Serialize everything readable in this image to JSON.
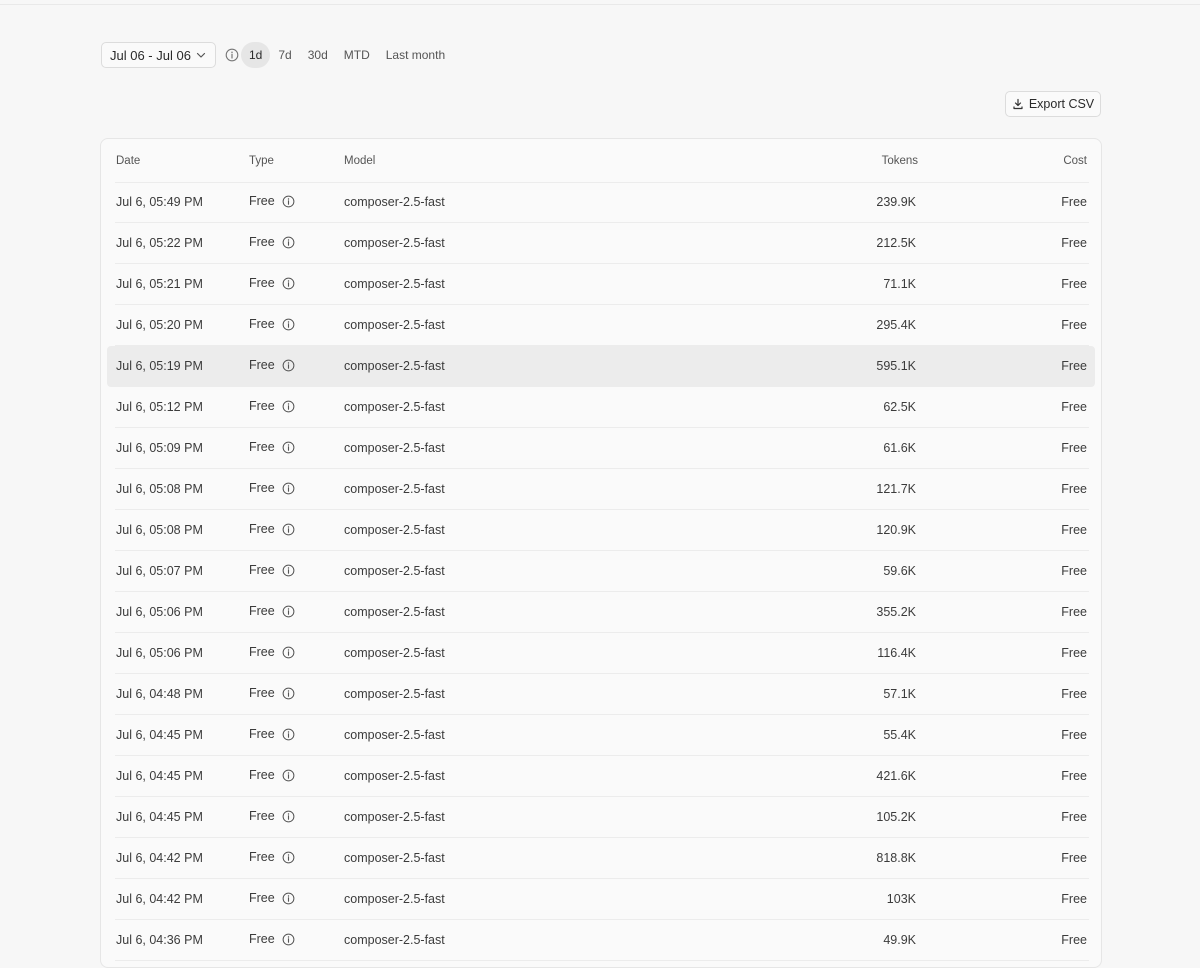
{
  "toolbar": {
    "date_range": "Jul 06 - Jul 06",
    "presets": [
      "1d",
      "7d",
      "30d",
      "MTD",
      "Last month"
    ],
    "active_preset": "1d",
    "icons": {
      "dropdown": "chevron-down-icon",
      "info": "info-icon"
    }
  },
  "export": {
    "label": "Export CSV",
    "icon": "download-icon"
  },
  "table": {
    "columns": [
      "Date",
      "Type",
      "Model",
      "Tokens",
      "Cost"
    ],
    "highlighted_row": 4,
    "rows": [
      {
        "date": "Jul 6, 05:49 PM",
        "type": "Free",
        "model": "composer-2.5-fast",
        "tokens": "239.9K",
        "cost": "Free"
      },
      {
        "date": "Jul 6, 05:22 PM",
        "type": "Free",
        "model": "composer-2.5-fast",
        "tokens": "212.5K",
        "cost": "Free"
      },
      {
        "date": "Jul 6, 05:21 PM",
        "type": "Free",
        "model": "composer-2.5-fast",
        "tokens": "71.1K",
        "cost": "Free"
      },
      {
        "date": "Jul 6, 05:20 PM",
        "type": "Free",
        "model": "composer-2.5-fast",
        "tokens": "295.4K",
        "cost": "Free"
      },
      {
        "date": "Jul 6, 05:19 PM",
        "type": "Free",
        "model": "composer-2.5-fast",
        "tokens": "595.1K",
        "cost": "Free"
      },
      {
        "date": "Jul 6, 05:12 PM",
        "type": "Free",
        "model": "composer-2.5-fast",
        "tokens": "62.5K",
        "cost": "Free"
      },
      {
        "date": "Jul 6, 05:09 PM",
        "type": "Free",
        "model": "composer-2.5-fast",
        "tokens": "61.6K",
        "cost": "Free"
      },
      {
        "date": "Jul 6, 05:08 PM",
        "type": "Free",
        "model": "composer-2.5-fast",
        "tokens": "121.7K",
        "cost": "Free"
      },
      {
        "date": "Jul 6, 05:08 PM",
        "type": "Free",
        "model": "composer-2.5-fast",
        "tokens": "120.9K",
        "cost": "Free"
      },
      {
        "date": "Jul 6, 05:07 PM",
        "type": "Free",
        "model": "composer-2.5-fast",
        "tokens": "59.6K",
        "cost": "Free"
      },
      {
        "date": "Jul 6, 05:06 PM",
        "type": "Free",
        "model": "composer-2.5-fast",
        "tokens": "355.2K",
        "cost": "Free"
      },
      {
        "date": "Jul 6, 05:06 PM",
        "type": "Free",
        "model": "composer-2.5-fast",
        "tokens": "116.4K",
        "cost": "Free"
      },
      {
        "date": "Jul 6, 04:48 PM",
        "type": "Free",
        "model": "composer-2.5-fast",
        "tokens": "57.1K",
        "cost": "Free"
      },
      {
        "date": "Jul 6, 04:45 PM",
        "type": "Free",
        "model": "composer-2.5-fast",
        "tokens": "55.4K",
        "cost": "Free"
      },
      {
        "date": "Jul 6, 04:45 PM",
        "type": "Free",
        "model": "composer-2.5-fast",
        "tokens": "421.6K",
        "cost": "Free"
      },
      {
        "date": "Jul 6, 04:45 PM",
        "type": "Free",
        "model": "composer-2.5-fast",
        "tokens": "105.2K",
        "cost": "Free"
      },
      {
        "date": "Jul 6, 04:42 PM",
        "type": "Free",
        "model": "composer-2.5-fast",
        "tokens": "818.8K",
        "cost": "Free"
      },
      {
        "date": "Jul 6, 04:42 PM",
        "type": "Free",
        "model": "composer-2.5-fast",
        "tokens": "103K",
        "cost": "Free"
      },
      {
        "date": "Jul 6, 04:36 PM",
        "type": "Free",
        "model": "composer-2.5-fast",
        "tokens": "49.9K",
        "cost": "Free"
      }
    ]
  }
}
